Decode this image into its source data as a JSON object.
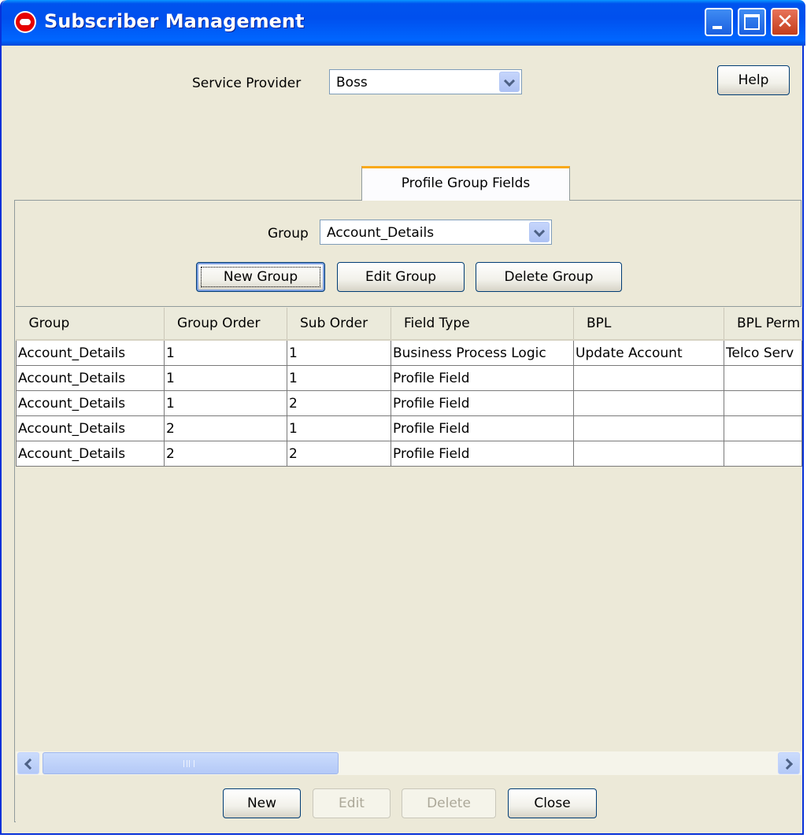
{
  "window": {
    "title": "Subscriber Management",
    "minimize_icon": "minimize-icon",
    "maximize_icon": "maximize-icon",
    "close_icon": "close-icon"
  },
  "header": {
    "service_provider_label": "Service Provider",
    "service_provider_value": "Boss",
    "help_label": "Help"
  },
  "tabs": [
    {
      "label": "Profile Group Fields",
      "selected": true
    }
  ],
  "group_panel": {
    "group_label": "Group",
    "group_value": "Account_Details",
    "new_group": "New Group",
    "edit_group": "Edit Group",
    "delete_group": "Delete Group"
  },
  "table": {
    "columns": [
      "Group",
      "Group Order",
      "Sub Order",
      "Field Type",
      "BPL",
      "BPL Perm"
    ],
    "rows": [
      [
        "Account_Details",
        "1",
        "1",
        "Business Process Logic",
        "Update Account",
        "Telco Serv"
      ],
      [
        "Account_Details",
        "1",
        "1",
        "Profile Field",
        "",
        ""
      ],
      [
        "Account_Details",
        "1",
        "2",
        "Profile Field",
        "",
        ""
      ],
      [
        "Account_Details",
        "2",
        "1",
        "Profile Field",
        "",
        ""
      ],
      [
        "Account_Details",
        "2",
        "2",
        "Profile Field",
        "",
        ""
      ]
    ]
  },
  "footer": {
    "new": "New",
    "edit": "Edit",
    "delete": "Delete",
    "close": "Close"
  },
  "colors": {
    "titlebar": "#0054e3",
    "window_bg": "#ece9d8",
    "tab_highlight": "#f9a91a"
  }
}
